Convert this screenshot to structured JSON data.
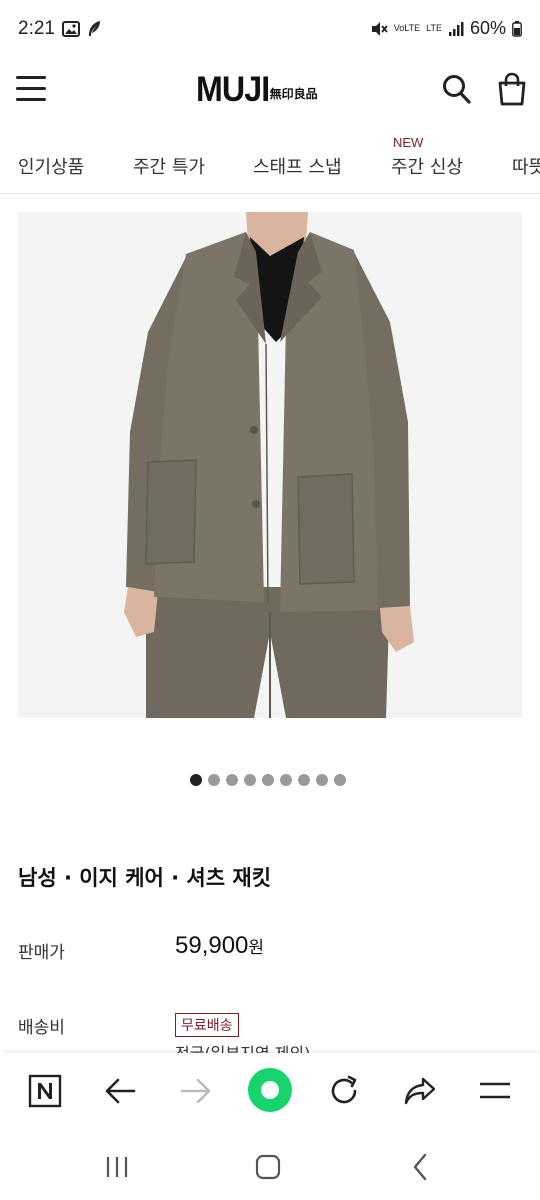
{
  "status_bar": {
    "time": "2:21",
    "network_label": "LTE",
    "carrier_label": "VoLTE",
    "battery": "60%"
  },
  "header": {
    "logo_main": "MUJI",
    "logo_sub": "無印良品"
  },
  "nav": {
    "items": [
      {
        "label": "인기상품"
      },
      {
        "label": "주간 특가"
      },
      {
        "label": "스태프 스냅"
      },
      {
        "label": "주간 신상",
        "badge": "NEW"
      },
      {
        "label": "따뜻"
      }
    ]
  },
  "carousel": {
    "total": 9,
    "current": 1
  },
  "product": {
    "title": "남성 · 이지 케어 · 셔츠 재킷",
    "price_label": "판매가",
    "price": "59,900",
    "price_unit": "원",
    "shipping_label": "배송비",
    "shipping_badge": "무료배송",
    "shipping_note": "전국(일부지역 제외)"
  },
  "colors": {
    "brand_red": "#7b1f24",
    "browser_green": "#16d36b",
    "jacket": "#7a7466"
  }
}
